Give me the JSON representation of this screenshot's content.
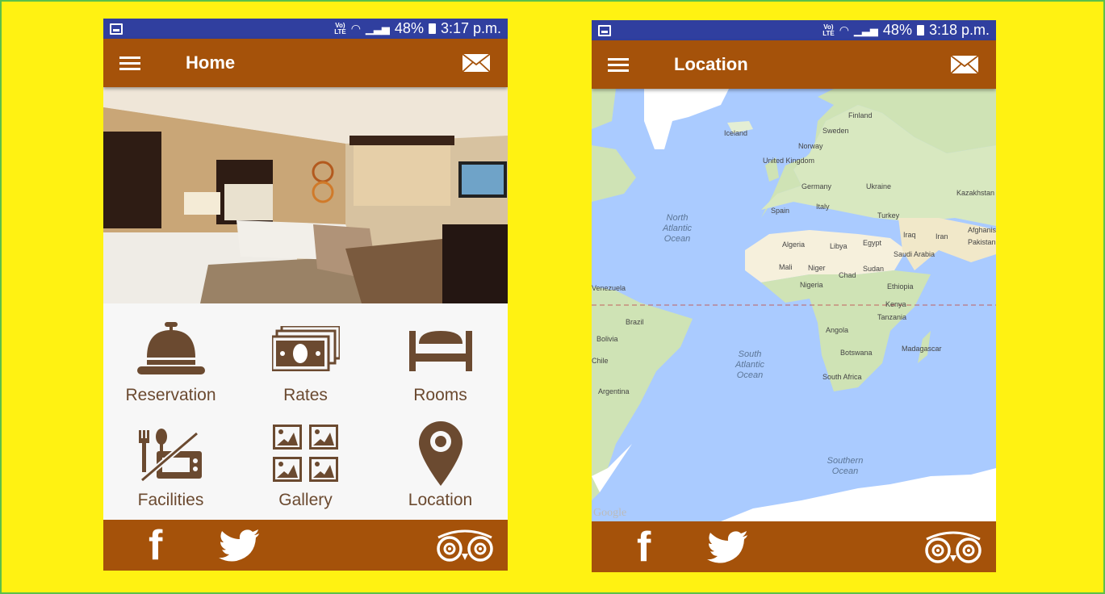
{
  "colors": {
    "background": "#fff212",
    "status_bar": "#303f9f",
    "app_bar": "#a5520a",
    "icon": "#6b4a30",
    "map_water": "#aacbff"
  },
  "screens": [
    {
      "status": {
        "network": "VoLTE",
        "battery": "48%",
        "time": "3:17 p.m."
      },
      "app_bar": {
        "menu_icon": "hamburger-icon",
        "title": "Home",
        "action_icon": "mail-icon"
      },
      "hero_image": "hotel-room-photo",
      "menu": [
        {
          "label": "Reservation",
          "icon": "service-bell-icon"
        },
        {
          "label": "Rates",
          "icon": "money-icon"
        },
        {
          "label": "Rooms",
          "icon": "bed-icon"
        },
        {
          "label": "Facilities",
          "icon": "facilities-icon"
        },
        {
          "label": "Gallery",
          "icon": "gallery-icon"
        },
        {
          "label": "Location",
          "icon": "map-pin-icon"
        }
      ],
      "bottom_bar": [
        {
          "icon": "facebook-icon",
          "glyph": "f"
        },
        {
          "icon": "twitter-icon"
        },
        {
          "icon": "tripadvisor-icon"
        }
      ]
    },
    {
      "status": {
        "network": "VoLTE",
        "battery": "48%",
        "time": "3:18 p.m."
      },
      "app_bar": {
        "menu_icon": "hamburger-icon",
        "title": "Location",
        "action_icon": "mail-icon"
      },
      "map": {
        "countries": [
          "Iceland",
          "Finland",
          "Sweden",
          "Norway",
          "United Kingdom",
          "Germany",
          "Ukraine",
          "Kazakhstan",
          "Spain",
          "Italy",
          "Turkey",
          "Iraq",
          "Iran",
          "Afghanistan",
          "Pakistan",
          "Algeria",
          "Libya",
          "Egypt",
          "Saudi Arabia",
          "Mali",
          "Niger",
          "Chad",
          "Sudan",
          "Nigeria",
          "Ethiopia",
          "Venezuela",
          "Kenya",
          "Tanzania",
          "Brazil",
          "Bolivia",
          "Angola",
          "Madagascar",
          "Botswana",
          "Chile",
          "South Africa",
          "Argentina"
        ],
        "oceans": [
          "North Atlantic Ocean",
          "South Atlantic Ocean",
          "Southern Ocean"
        ],
        "attribution": "Google"
      },
      "bottom_bar": [
        {
          "icon": "facebook-icon",
          "glyph": "f"
        },
        {
          "icon": "twitter-icon"
        },
        {
          "icon": "tripadvisor-icon"
        }
      ]
    }
  ]
}
